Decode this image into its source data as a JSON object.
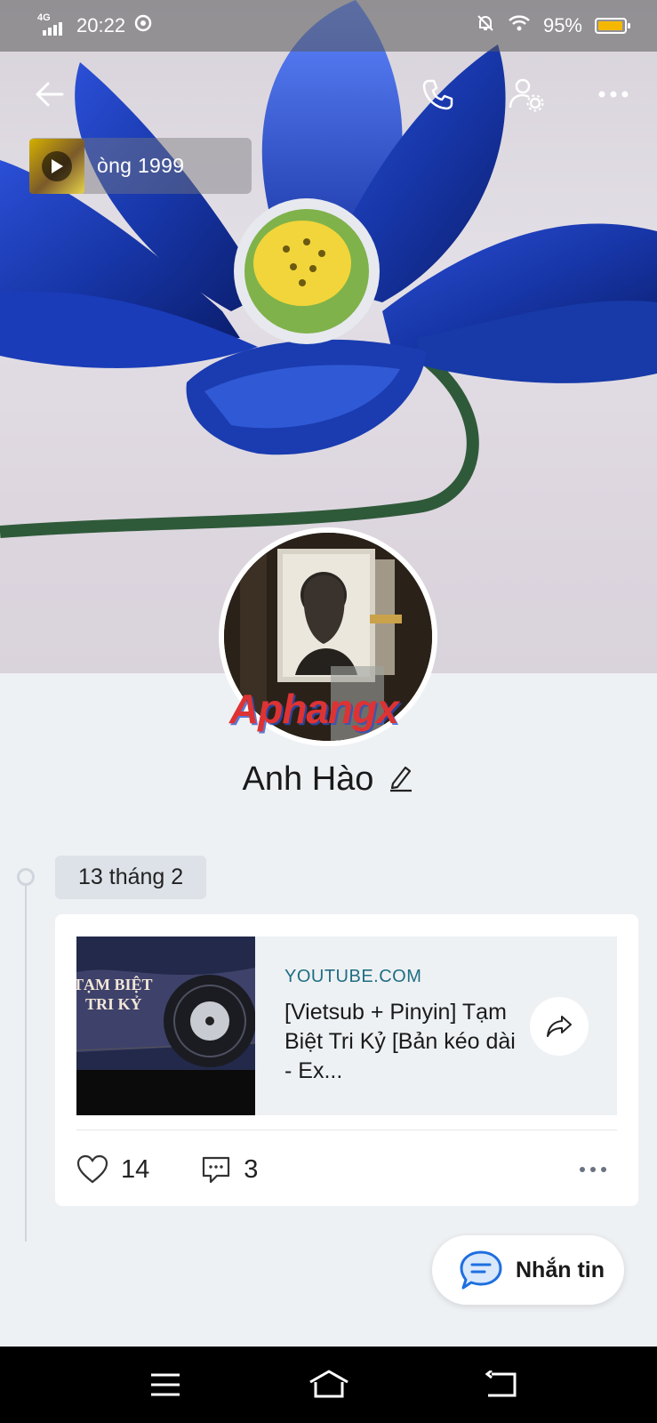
{
  "status_bar": {
    "network": "4G",
    "time": "20:22",
    "battery_percent": "95%",
    "battery_level": 0.95,
    "accent": "#f5b800"
  },
  "top_nav": {
    "back_icon": "arrow-left-icon",
    "call_icon": "phone-icon",
    "settings_icon": "user-settings-icon",
    "more_icon": "more-horizontal-icon"
  },
  "music": {
    "title": "òng 1999",
    "play_icon": "play-icon"
  },
  "profile": {
    "name": "Anh Hào",
    "edit_icon": "pencil-icon",
    "watermark": "Aphangx"
  },
  "timeline": {
    "date": "13 tháng 2"
  },
  "post": {
    "link_domain": "YOUTUBE.COM",
    "link_title": "[Vietsub + Pinyin] Tạm Biệt Tri Kỷ [Bản kéo dài - Ex...",
    "thumb_title": "TẠM BIỆT TRI KỶ",
    "share_icon": "share-arrow-icon",
    "likes": "14",
    "comments": "3",
    "like_icon": "heart-icon",
    "comment_icon": "comment-icon",
    "more_icon": "more-horizontal-icon"
  },
  "message_button": {
    "label": "Nhắn tin",
    "icon": "chat-bubble-icon",
    "accent": "#1e6fe0"
  },
  "system_nav": {
    "menu_icon": "menu-icon",
    "home_icon": "home-icon",
    "back_icon": "return-icon"
  }
}
